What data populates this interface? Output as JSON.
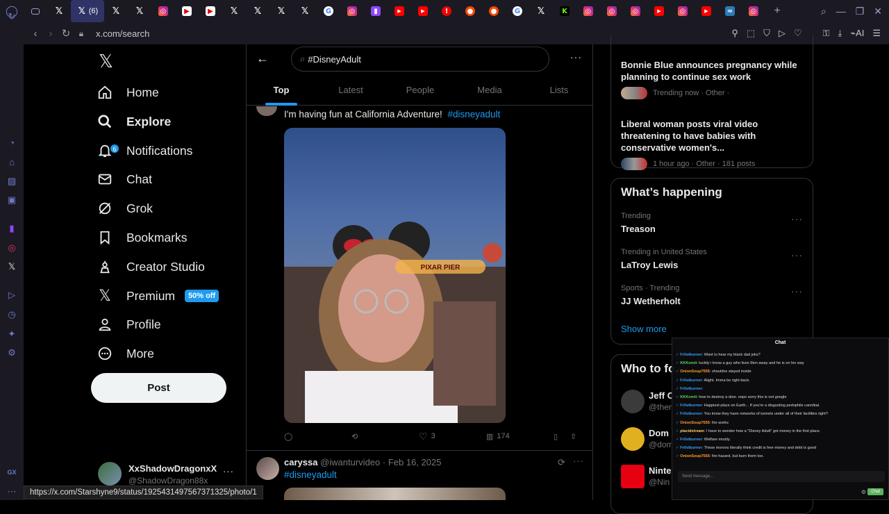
{
  "browser": {
    "active_tab_label": "(6)",
    "url": "x.com/search",
    "ai_label": "AI",
    "status_url": "https://x.com/Starshyne9/status/1925431497567371325/photo/1",
    "tab_colors": [
      "#1b1a23",
      "#000000",
      "#2f3366",
      "#000000",
      "#000000",
      "#e1306c",
      "#ffffff",
      "#ffffff",
      "#000000",
      "#000000",
      "#000000",
      "#000000",
      "#4285f4",
      "#e1306c",
      "#9146ff",
      "#ff0000",
      "#ff0000",
      "#ff0000",
      "#ff4500",
      "#ff4500",
      "#4285f4",
      "#000000",
      "#53fc18",
      "#e1306c",
      "#e1306c",
      "#e1306c",
      "#ff0000",
      "#e1306c",
      "#ff0000",
      "#2b7bb9",
      "#e1306c"
    ]
  },
  "nav": {
    "items": [
      {
        "label": "Home",
        "icon": "home-icon"
      },
      {
        "label": "Explore",
        "icon": "search-icon"
      },
      {
        "label": "Notifications",
        "icon": "bell-icon",
        "badge": "6"
      },
      {
        "label": "Chat",
        "icon": "mail-icon"
      },
      {
        "label": "Grok",
        "icon": "grok-icon"
      },
      {
        "label": "Bookmarks",
        "icon": "bookmark-icon"
      },
      {
        "label": "Creator Studio",
        "icon": "creator-icon"
      },
      {
        "label": "Premium",
        "icon": "x-logo-icon",
        "badge": "50% off"
      },
      {
        "label": "Profile",
        "icon": "person-icon"
      },
      {
        "label": "More",
        "icon": "more-circle-icon"
      }
    ],
    "post_label": "Post",
    "account": {
      "name": "XxShadowDragonxX",
      "handle": "@ShadowDragon88x"
    }
  },
  "search": {
    "query": "#DisneyAdult",
    "tabs": [
      "Top",
      "Latest",
      "People",
      "Media",
      "Lists"
    ],
    "selected_tab": "Top"
  },
  "tweets": [
    {
      "text": "I'm having fun at California Adventure!",
      "hashtag": "#disneyadult",
      "photo_sign": "PIXAR PIER",
      "likes": "3",
      "views": "174"
    },
    {
      "name": "caryssa",
      "handle": "@iwanturvideo",
      "date": "· Feb 16, 2025",
      "hashtag": "#disneyadult"
    }
  ],
  "right": {
    "news": [
      {
        "title": "Bonnie Blue announces pregnancy while planning to continue sex work",
        "meta": "Trending now · Other ·"
      },
      {
        "title": "Liberal woman posts viral video threatening to have babies with conservative women's...",
        "meta": "1 hour ago · Other · 181 posts"
      }
    ],
    "happening_title": "What’s happening",
    "trends": [
      {
        "context": "Trending",
        "name": "Treason"
      },
      {
        "context": "Trending in United States",
        "name": "LaTroy Lewis"
      },
      {
        "context": "Sports · Trending",
        "name": "JJ Wetherholt"
      }
    ],
    "show_more": "Show more",
    "who_to_follow_title": "Who to fo",
    "follow": [
      {
        "name": "Jeff C",
        "handle": "@ther"
      },
      {
        "name": "Dom I",
        "handle": "@dom"
      },
      {
        "name": "Ninte",
        "handle": "@Nin"
      }
    ]
  },
  "chat": {
    "title": "Chat",
    "messages": [
      {
        "user": "Fr0stburner",
        "color": "#3aa0ff",
        "text": "Want to hear my black dad joks?"
      },
      {
        "user": "KKKomit",
        "color": "#5fd35f",
        "text": "luckily i know a guy who lives 6km away and he is on his way"
      },
      {
        "user": "OnionSoup7555",
        "color": "#ff9f2a",
        "text": "shouldve stayed inside"
      },
      {
        "user": "Fr0stburner",
        "color": "#3aa0ff",
        "text": "Alight. Imma be right back."
      },
      {
        "user": "Fr0stburner",
        "color": "#3aa0ff",
        "text": ""
      },
      {
        "user": "KKKomit",
        "color": "#5fd35f",
        "text": "how to destroy a door. oops sorry this is not google"
      },
      {
        "user": "Fr0stburner",
        "color": "#3aa0ff",
        "text": "Happiest place on Earth... If you're a disgusting pedophile cannibal."
      },
      {
        "user": "Fr0stburner",
        "color": "#3aa0ff",
        "text": "You know they have networks of tunnels under all of their facilities right?"
      },
      {
        "user": "OnionSoup7555",
        "color": "#ff9f2a",
        "text": "fire works"
      },
      {
        "user": "placidstream",
        "color": "#ffd166",
        "text": "I have to wonder how a \"Disney Adult\" got money in the first place."
      },
      {
        "user": "Fr0stburner",
        "color": "#3aa0ff",
        "text": "Welfare mostly."
      },
      {
        "user": "Fr0stburner",
        "color": "#3aa0ff",
        "text": "These morons literally think credit is free money and debt is good"
      },
      {
        "user": "OnionSoup7555",
        "color": "#ff9f2a",
        "text": "fire hazard, but burn them too."
      }
    ],
    "placeholder": "Send message...",
    "send_label": "Chat"
  }
}
